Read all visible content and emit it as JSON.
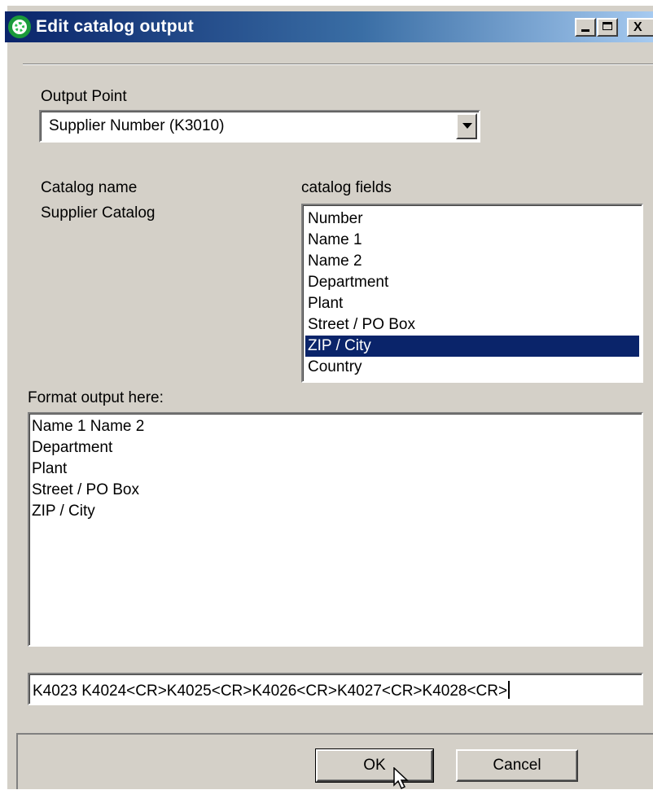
{
  "window": {
    "title": "Edit catalog output",
    "minimize_icon": "minimize-icon",
    "maximize_icon": "maximize-icon",
    "close_icon": "close-icon",
    "close_glyph": "X"
  },
  "output_point": {
    "label": "Output Point",
    "selected": "Supplier Number (K3010)"
  },
  "catalog": {
    "name_label": "Catalog name",
    "name_value": "Supplier Catalog",
    "fields_label": "catalog fields",
    "fields": [
      "Number",
      "Name 1",
      "Name 2",
      "Department",
      "Plant",
      "Street / PO Box",
      "ZIP / City",
      "Country"
    ],
    "selected_index": 6
  },
  "format": {
    "label": "Format output here:",
    "lines": [
      "Name 1 Name 2",
      "Department",
      "Plant",
      "Street / PO Box",
      "ZIP / City"
    ]
  },
  "code": {
    "value": "K4023 K4024<CR>K4025<CR>K4026<CR>K4027<CR>K4028<CR>"
  },
  "buttons": {
    "ok": "OK",
    "cancel": "Cancel"
  },
  "colors": {
    "title_bar": "#0a246a",
    "selection": "#0a246a",
    "dialog_bg": "#d4d0c8"
  }
}
